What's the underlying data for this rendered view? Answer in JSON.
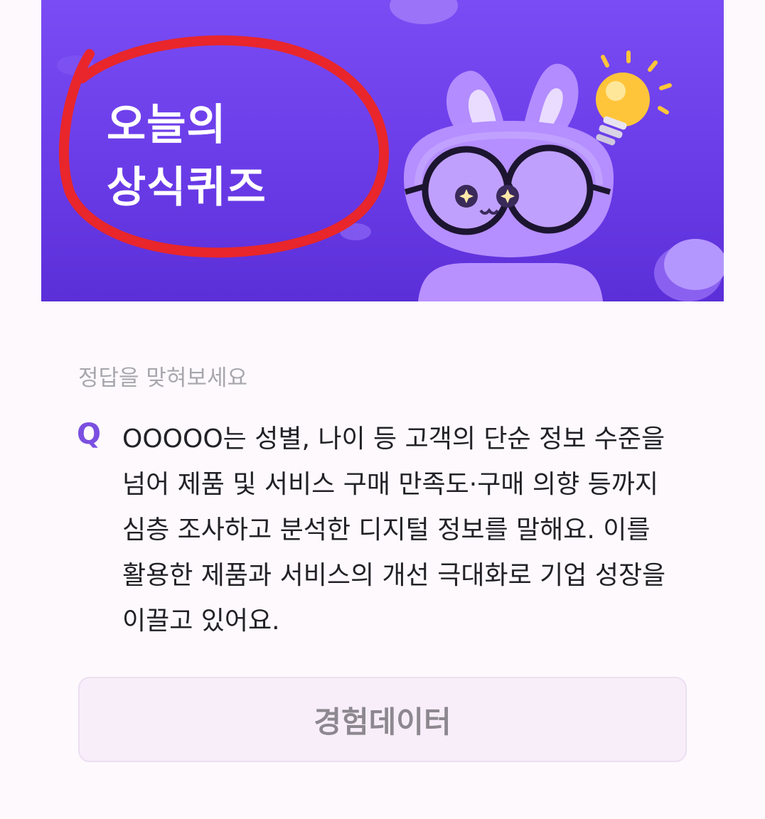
{
  "banner": {
    "title_line1": "오늘의",
    "title_line2": "상식퀴즈",
    "annotation_color": "#e8262b",
    "background_color": "#6a3ce8",
    "mascot": "purple-rabbit-with-glasses",
    "bulb": "lightbulb-icon"
  },
  "quiz": {
    "prompt": "정답을 맞혀보세요",
    "q_label": "Q",
    "question_lines": [
      "OOOOO는 성별, 나이 등 고객의 단순 정보 수준을",
      "넘어 제품 및 서비스 구매 만족도·구매 의향 등까지",
      "심층 조사하고 분석한 디지털 정보를 말해요. 이를",
      "활용한 제품과 서비스의 개선 극대화로 기업 성장을",
      "이끌고 있어요."
    ],
    "answer_label": "경험데이터",
    "accent_color": "#7b4fe0"
  }
}
